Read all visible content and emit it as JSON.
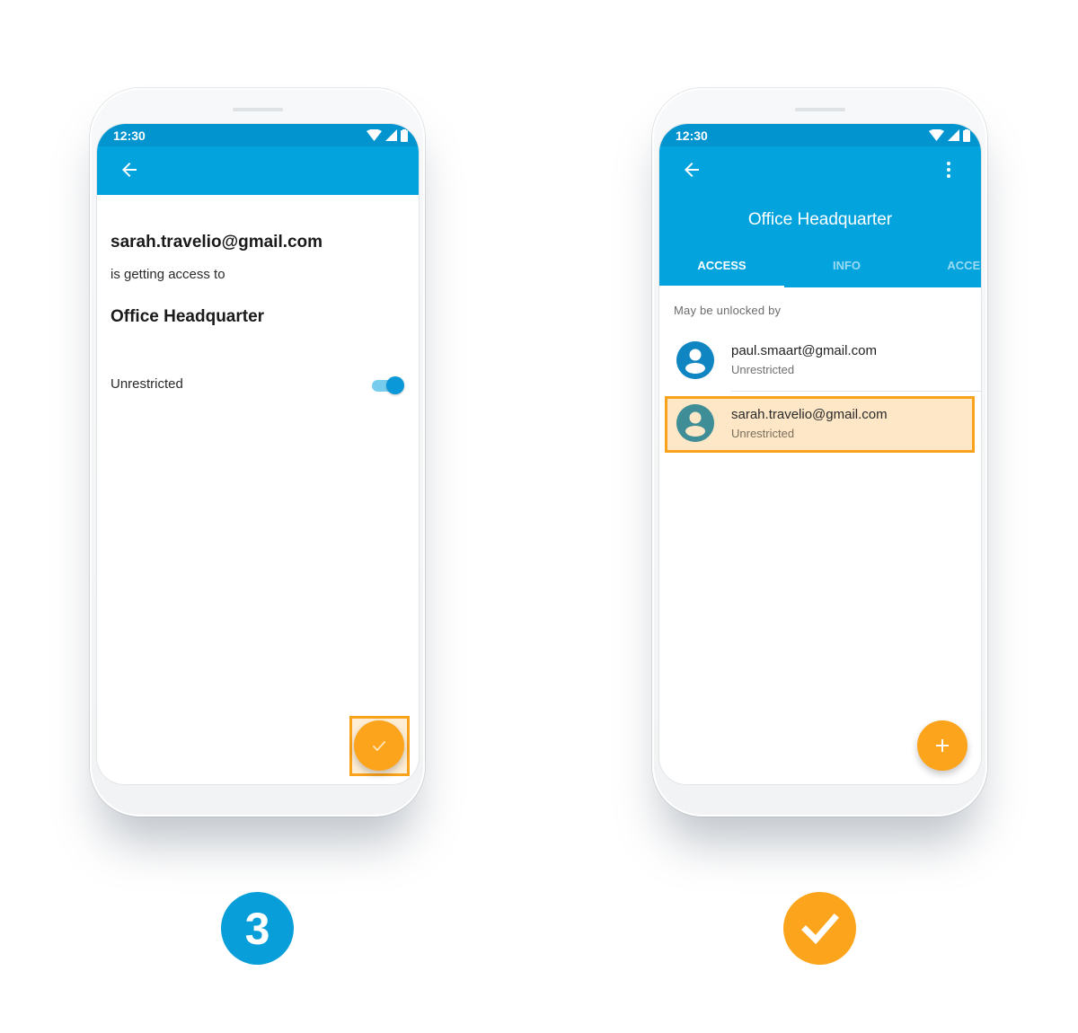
{
  "colors": {
    "primary": "#03a3de",
    "statusbar": "#0294cf",
    "accent": "#fca41b",
    "highlight_border": "#f9a21b",
    "highlight_fill": "#fde7c6"
  },
  "left_phone": {
    "statusbar": {
      "time": "12:30",
      "icons": [
        "wifi-icon",
        "signal-icon",
        "battery-icon"
      ]
    },
    "appbar": {
      "back_icon": "arrow-back-icon"
    },
    "content": {
      "email": "sarah.travelio@gmail.com",
      "subtext": "is getting access to",
      "lock_name": "Office Headquarter",
      "toggle_label": "Unrestricted",
      "toggle_on": true
    },
    "fab": {
      "icon": "check-icon",
      "highlighted": true
    }
  },
  "right_phone": {
    "statusbar": {
      "time": "12:30",
      "icons": [
        "wifi-icon",
        "signal-icon",
        "battery-icon"
      ]
    },
    "appbar": {
      "back_icon": "arrow-back-icon",
      "more_icon": "more-vertical-icon",
      "title": "Office Headquarter",
      "tabs": [
        {
          "label": "ACCESS",
          "active": true
        },
        {
          "label": "INFO",
          "active": false
        },
        {
          "label": "ACCESS",
          "active": false
        }
      ]
    },
    "content": {
      "section_label": "May be unlocked by",
      "users": [
        {
          "email": "paul.smaart@gmail.com",
          "access": "Unrestricted",
          "avatar_color": "#0f86c2",
          "highlighted": false
        },
        {
          "email": "sarah.travelio@gmail.com",
          "access": "Unrestricted",
          "avatar_color": "#3f8d96",
          "highlighted": true
        }
      ]
    },
    "fab": {
      "icon": "plus-icon"
    }
  },
  "steps": {
    "left_badge": "3",
    "right_badge_icon": "check-icon"
  }
}
